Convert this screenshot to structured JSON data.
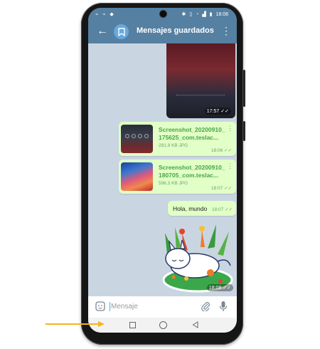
{
  "status_bar": {
    "left_icons": "⌁ ⌁ ◆",
    "icons": [
      "bluetooth-icon",
      "vibrate-icon",
      "wifi-icon",
      "signal-icon",
      "battery-icon"
    ],
    "time": "18:08"
  },
  "app_bar": {
    "title": "Mensajes guardados",
    "back_icon": "arrow-left-icon",
    "avatar_icon": "bookmark-icon",
    "more_icon": "more-vertical-icon"
  },
  "messages": {
    "photo": {
      "time": "17:57"
    },
    "files": [
      {
        "name": "Screenshot_20200910_175625_com.teslac...",
        "size": "281,9 KB JPG",
        "time": "18:06"
      },
      {
        "name": "Screenshot_20200910_180705_com.teslac...",
        "size": "596,3 KB JPG",
        "time": "18:07"
      }
    ],
    "text": {
      "body": "Hola, mundo",
      "time": "18:07"
    },
    "sticker": {
      "time": "18:08"
    }
  },
  "input_bar": {
    "placeholder": "Mensaje",
    "value": ""
  },
  "colors": {
    "header": "#5580a2",
    "chat_background": "#c9d6e1",
    "outgoing_bubble": "#e1ffc7",
    "file_name": "#4aa448",
    "annotation_arrow": "#f2b51c"
  }
}
